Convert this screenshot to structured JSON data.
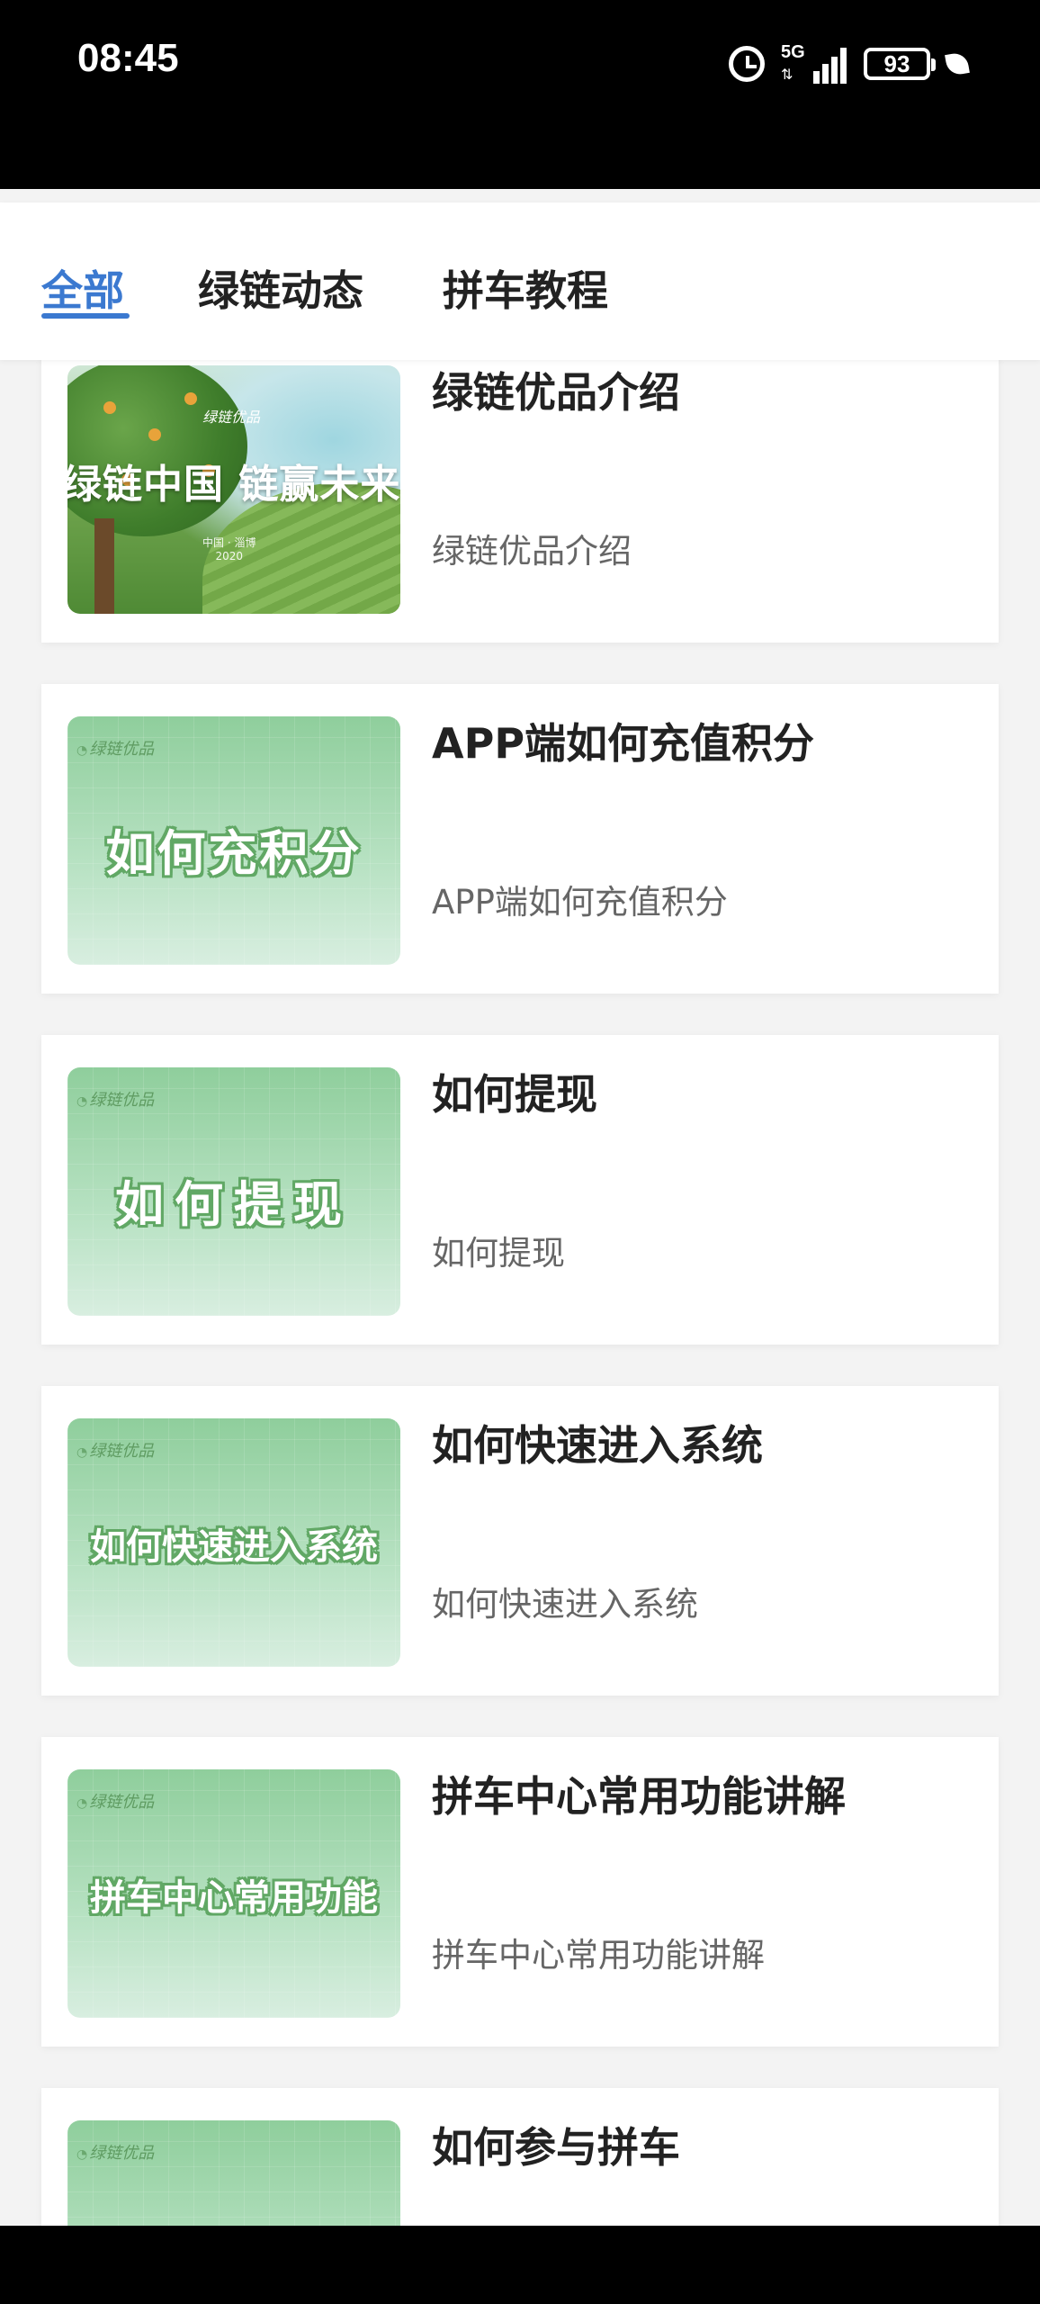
{
  "status_bar": {
    "time": "08:45",
    "network": "5G",
    "battery": "93",
    "icons": [
      "alarm-icon",
      "signal-icon",
      "battery-icon",
      "leaf-icon"
    ]
  },
  "tabs": [
    {
      "label": "全部",
      "active": true
    },
    {
      "label": "绿链动态",
      "active": false
    },
    {
      "label": "拼车教程",
      "active": false
    }
  ],
  "thumb1": {
    "brand": "绿链优品",
    "text": "绿链中国 链赢未来",
    "sub": "中国 · 淄博\n2020"
  },
  "items": [
    {
      "title": "绿链优品介绍",
      "desc": "绿链优品介绍"
    },
    {
      "title": "APP端如何充值积分",
      "desc": "APP端如何充值积分",
      "thumb_text": "如何充积分",
      "thumb_brand": "绿链优品"
    },
    {
      "title": "如何提现",
      "desc": "如何提现",
      "thumb_text": "如何提现",
      "thumb_brand": "绿链优品"
    },
    {
      "title": "如何快速进入系统",
      "desc": "如何快速进入系统",
      "thumb_text": "如何快速进入系统",
      "thumb_brand": "绿链优品"
    },
    {
      "title": "拼车中心常用功能讲解",
      "desc": "拼车中心常用功能讲解",
      "thumb_text": "拼车中心常用功能",
      "thumb_brand": "绿链优品"
    },
    {
      "title": "如何参与拼车",
      "desc": "",
      "thumb_text": "",
      "thumb_brand": "绿链优品"
    }
  ],
  "colors": {
    "accent": "#3b79d0",
    "thumb_green": "#8fce9c"
  }
}
